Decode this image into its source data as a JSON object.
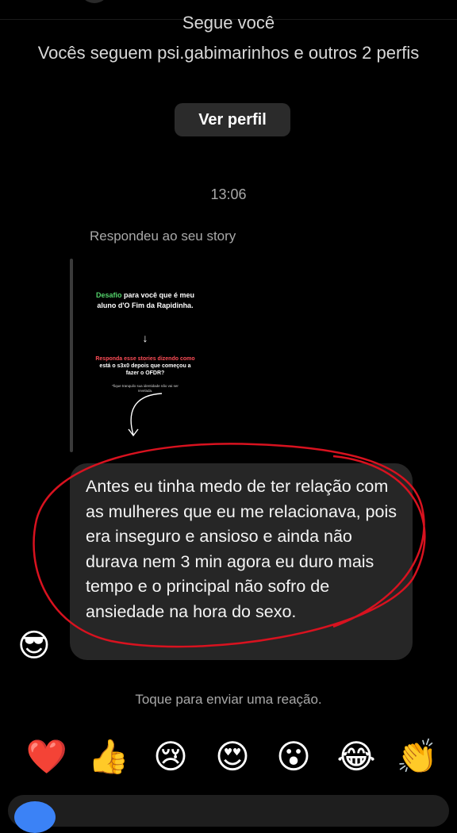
{
  "header": {
    "follows_you": "Segue você",
    "mutual_followers": "Vocês seguem psi.gabimarinhos e outros 2 perfis",
    "view_profile_button": "Ver perfil"
  },
  "conversation": {
    "timestamp": "13:06",
    "reply_context": "Respondeu ao seu story",
    "story": {
      "line1_highlight": "Desafio",
      "line1_rest": " para você que é meu aluno d'O Fim da Rapidinha.",
      "arrow": "↓",
      "line2_prefix": "Responda esse stories dizendo ",
      "line2_highlight": "como",
      "line2_rest": " está o s3x0 depois que começou a fazer o OFDR?",
      "line3": "*fique tranquilo sua identidade não vai ser revelada."
    },
    "message_text": "Antes eu tinha medo de ter relação com as mulheres que eu me relacionava, pois era inseguro e ansioso e ainda não durava nem 3 min agora eu duro mais tempo e o principal não sofro de ansiedade na hora do sexo.",
    "sender_avatar_emoji": "😎",
    "annotation_color": "#d8121f"
  },
  "reactions": {
    "hint": "Toque para enviar uma reação.",
    "emojis": [
      "❤️",
      "👍",
      "😢",
      "😍",
      "😮",
      "😂",
      "👏"
    ]
  }
}
